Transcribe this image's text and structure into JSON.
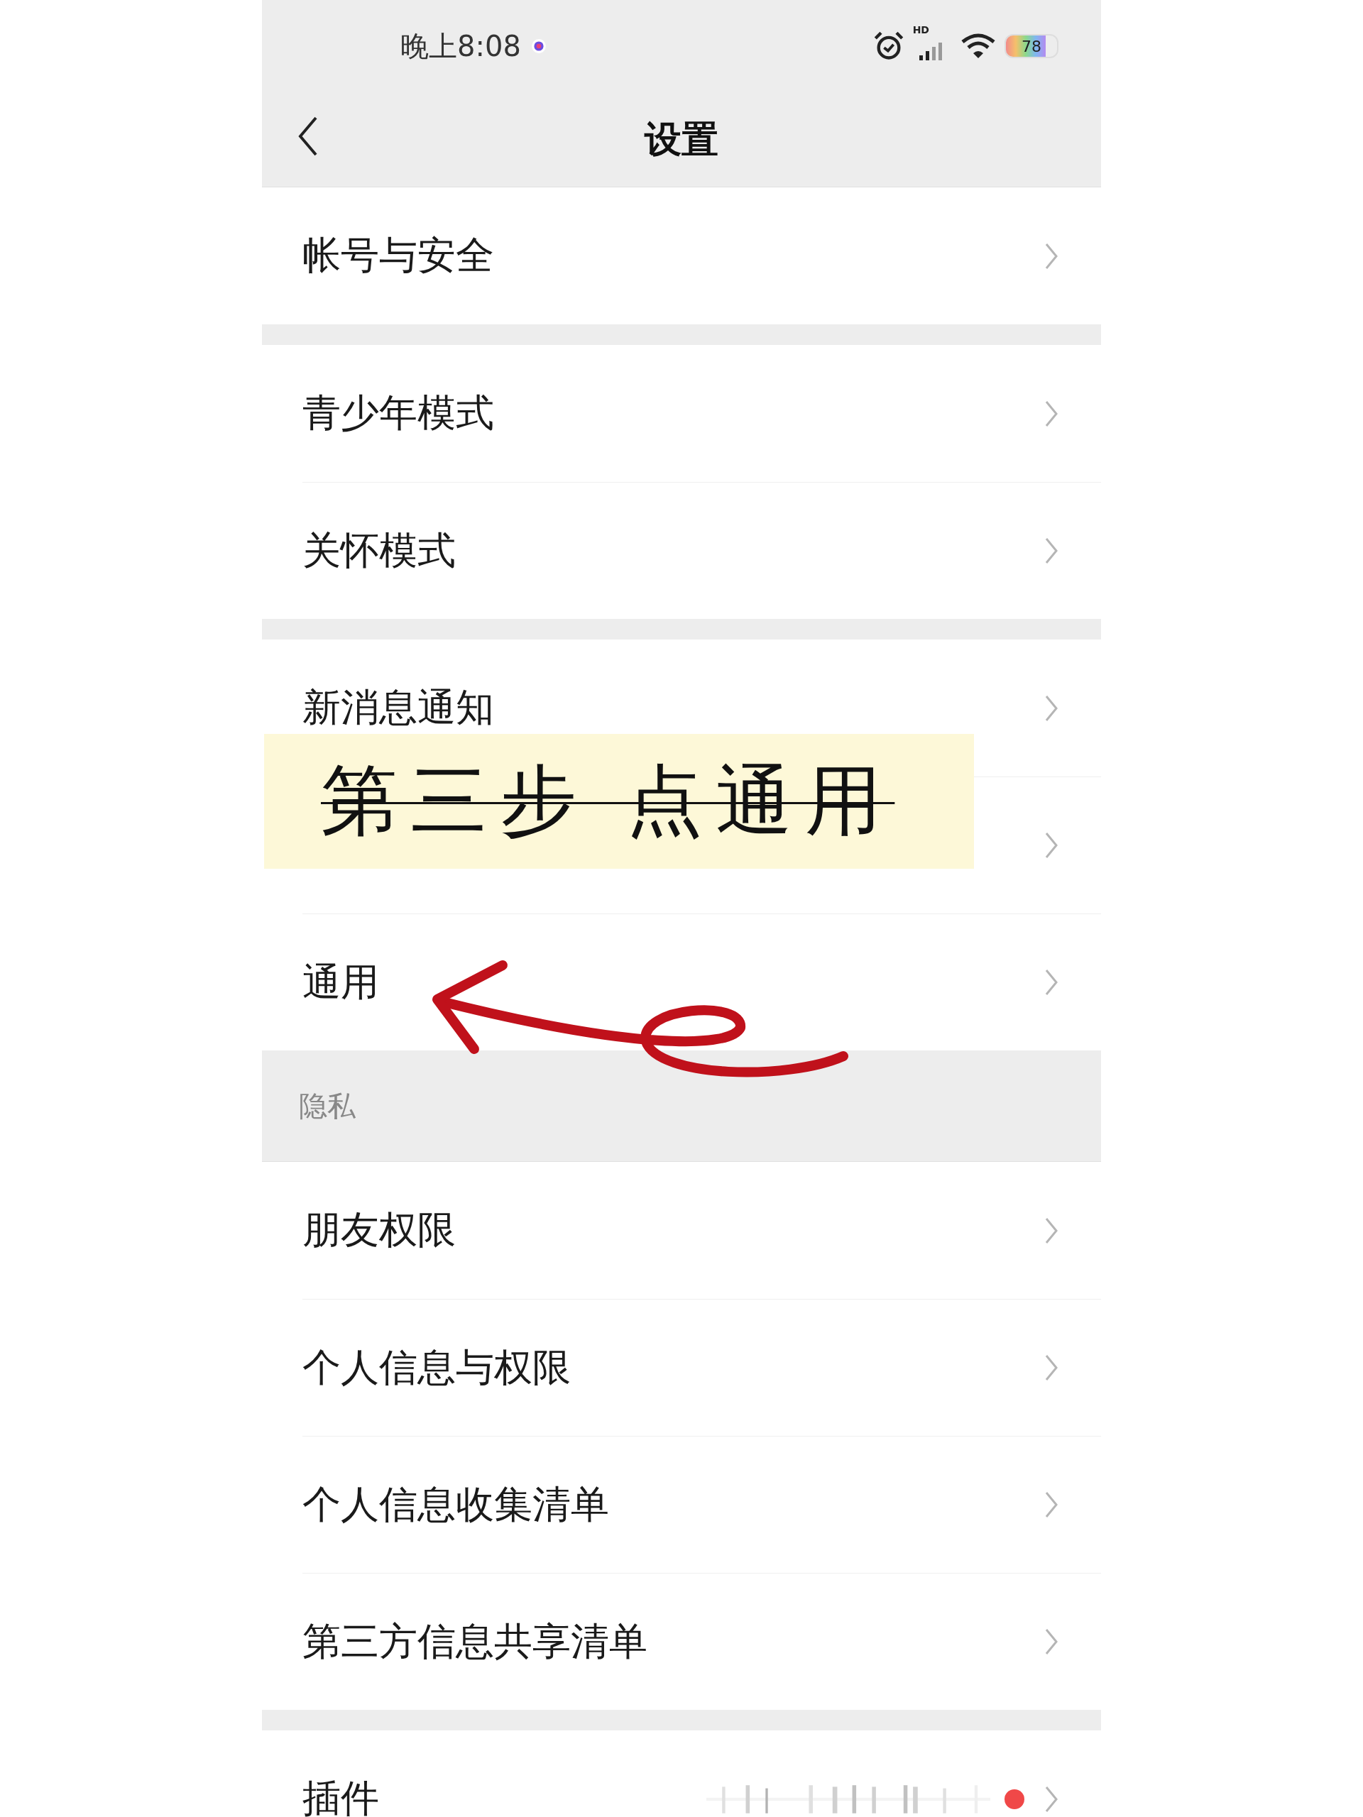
{
  "status_bar": {
    "time": "晚上8:08",
    "network_label": "HD",
    "battery": "78"
  },
  "header": {
    "title": "设置"
  },
  "sections": [
    {
      "items": [
        {
          "label": "帐号与安全"
        }
      ]
    },
    {
      "items": [
        {
          "label": "青少年模式"
        },
        {
          "label": "关怀模式"
        }
      ]
    },
    {
      "items": [
        {
          "label": "新消息通知"
        },
        {
          "kind": "covered"
        },
        {
          "label": "通用"
        }
      ]
    },
    {
      "header": "隐私",
      "items": [
        {
          "label": "朋友权限"
        },
        {
          "label": "个人信息与权限"
        },
        {
          "label": "个人信息收集清单"
        },
        {
          "label": "第三方信息共享清单"
        }
      ]
    },
    {
      "items": [
        {
          "label": "插件",
          "dot": true,
          "kind": "plugins"
        }
      ]
    }
  ],
  "annotation": {
    "text": "第三步 点通用"
  }
}
